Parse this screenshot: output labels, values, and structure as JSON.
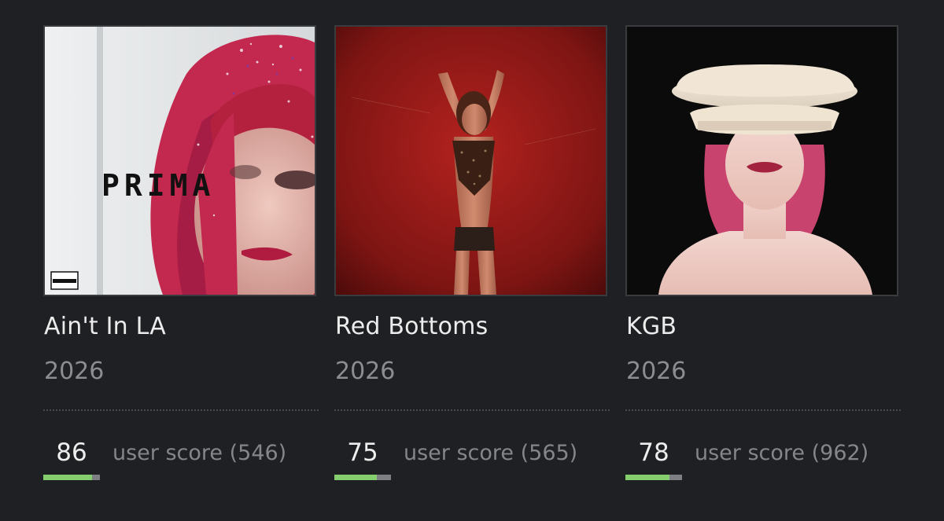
{
  "albums": [
    {
      "cover_text": "PRIMA",
      "title": "Ain't In LA",
      "year": "2026",
      "score": "86",
      "score_label": "user score (546)",
      "score_fraction": 0.86,
      "score_color": "#85ce6e"
    },
    {
      "title": "Red Bottoms",
      "year": "2026",
      "score": "75",
      "score_label": "user score (565)",
      "score_fraction": 0.75,
      "score_color": "#85ce6e"
    },
    {
      "title": "KGB",
      "year": "2026",
      "score": "78",
      "score_label": "user score (962)",
      "score_fraction": 0.78,
      "score_color": "#85ce6e"
    }
  ]
}
